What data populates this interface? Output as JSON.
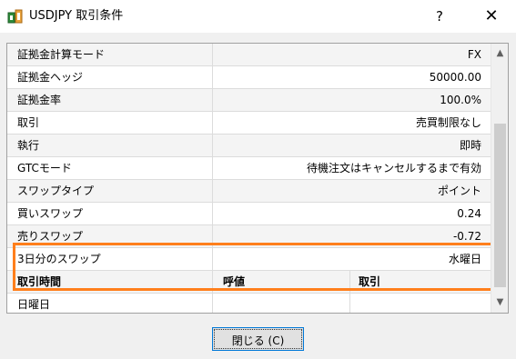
{
  "window": {
    "title": "USDJPY 取引条件",
    "help_glyph": "?",
    "close_glyph": "✕"
  },
  "properties": [
    {
      "key": "証拠金計算モード",
      "value": "FX"
    },
    {
      "key": "証拠金ヘッジ",
      "value": "50000.00"
    },
    {
      "key": "証拠金率",
      "value": "100.0%"
    },
    {
      "key": "取引",
      "value": "売買制限なし"
    },
    {
      "key": "執行",
      "value": "即時"
    },
    {
      "key": "GTCモード",
      "value": "待機注文はキャンセルするまで有効"
    },
    {
      "key": "スワップタイプ",
      "value": "ポイント"
    },
    {
      "key": "買いスワップ",
      "value": "0.24"
    },
    {
      "key": "売りスワップ",
      "value": "-0.72"
    },
    {
      "key": "3日分のスワップ",
      "value": "水曜日"
    }
  ],
  "session_table": {
    "headers": [
      "取引時間",
      "呼値",
      "取引"
    ],
    "rows": [
      [
        "日曜日",
        "",
        ""
      ]
    ]
  },
  "scrollbar": {
    "up_glyph": "▲",
    "down_glyph": "▼"
  },
  "footer": {
    "close_button_label": "閉じる (C)"
  },
  "colors": {
    "highlight": "#ff7f1c",
    "accent": "#0078d7"
  }
}
